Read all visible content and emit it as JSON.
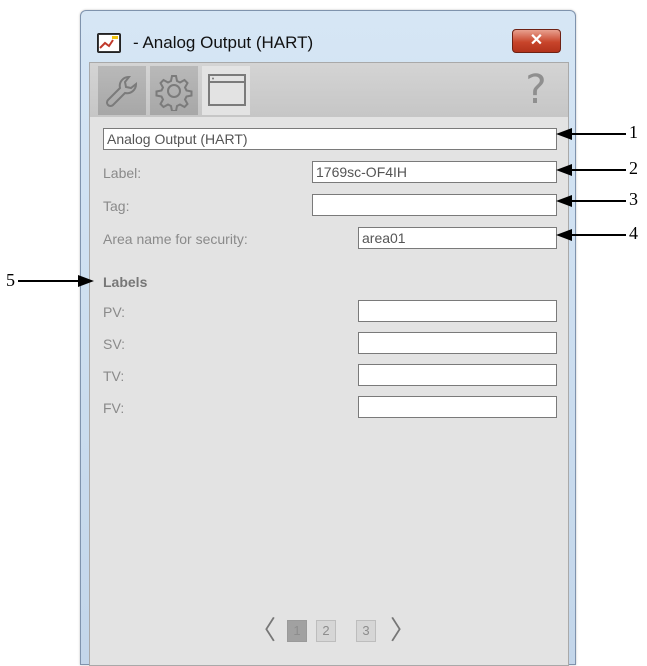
{
  "window": {
    "title": "- Analog Output (HART)",
    "close_label": "✕"
  },
  "toolbar": {
    "tabs": [
      {
        "icon": "wrench-icon",
        "active": false
      },
      {
        "icon": "gear-icon",
        "active": false
      },
      {
        "icon": "window-icon",
        "active": true
      }
    ],
    "help_label": "?"
  },
  "form": {
    "description_value": "Analog Output (HART)",
    "label_label": "Label:",
    "label_value": "1769sc-OF4IH",
    "tag_label": "Tag:",
    "tag_value": "",
    "area_label": "Area name for security:",
    "area_value": "area01"
  },
  "labels_section": {
    "heading": "Labels",
    "rows": [
      {
        "label": "PV:",
        "value": ""
      },
      {
        "label": "SV:",
        "value": ""
      },
      {
        "label": "TV:",
        "value": ""
      },
      {
        "label": "FV:",
        "value": ""
      }
    ]
  },
  "pager": {
    "prev": "〈",
    "next": "〉",
    "pages": [
      "1",
      "2",
      "3"
    ],
    "current_page": "1"
  },
  "callouts": [
    "1",
    "2",
    "3",
    "4",
    "5"
  ]
}
